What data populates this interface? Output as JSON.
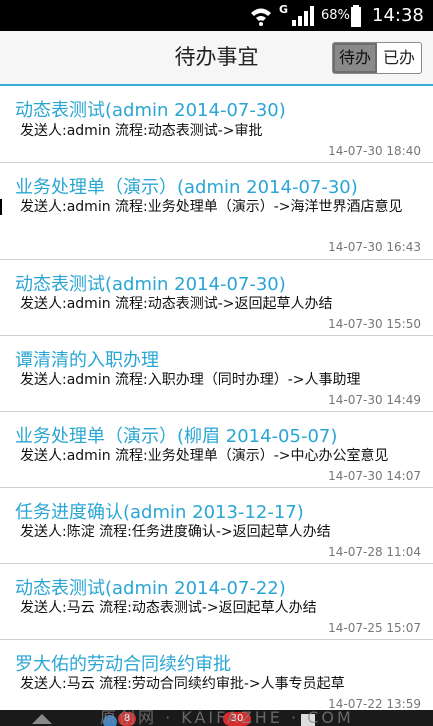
{
  "status_bar": {
    "network_mark": "G",
    "battery": "68%",
    "time": "14:38",
    "icons": [
      "wifi-icon",
      "signal-icon",
      "battery-icon"
    ]
  },
  "header": {
    "title": "待办事宜",
    "toggle": {
      "active": "待办",
      "inactive": "已办"
    }
  },
  "items": [
    {
      "title": "动态表测试(admin 2014-07-30)",
      "desc": "发送人:admin 流程:动态表测试->审批",
      "time": "14-07-30 18:40"
    },
    {
      "title": "业务处理单（演示）(admin 2014-07-30)",
      "desc": "发送人:admin 流程:业务处理单（演示）->海洋世界酒店意见",
      "time": "14-07-30 16:43"
    },
    {
      "title": "动态表测试(admin 2014-07-30)",
      "desc": "发送人:admin 流程:动态表测试->返回起草人办结",
      "time": "14-07-30 15:50"
    },
    {
      "title": "谭清清的入职办理",
      "desc": "发送人:admin 流程:入职办理（同时办理）->人事助理",
      "time": "14-07-30 14:49"
    },
    {
      "title": "业务处理单（演示）(柳眉 2014-05-07)",
      "desc": "发送人:admin 流程:业务处理单（演示）->中心办公室意见",
      "time": "14-07-30 14:07"
    },
    {
      "title": "任务进度确认(admin 2013-12-17)",
      "desc": "发送人:陈淀 流程:任务进度确认->返回起草人办结",
      "time": "14-07-28 11:04"
    },
    {
      "title": "动态表测试(admin 2014-07-22)",
      "desc": "发送人:马云 流程:动态表测试->返回起草人办结",
      "time": "14-07-25 15:07"
    },
    {
      "title": "罗大佑的劳动合同续约审批",
      "desc": "发送人:马云 流程:劳动合同续约审批->人事专员起草",
      "time": "14-07-22 13:59"
    }
  ],
  "nav_bar": {
    "badge_1": "8",
    "badge_2": "30",
    "watermark": "原创网 · KAIFAZHE · COM"
  }
}
